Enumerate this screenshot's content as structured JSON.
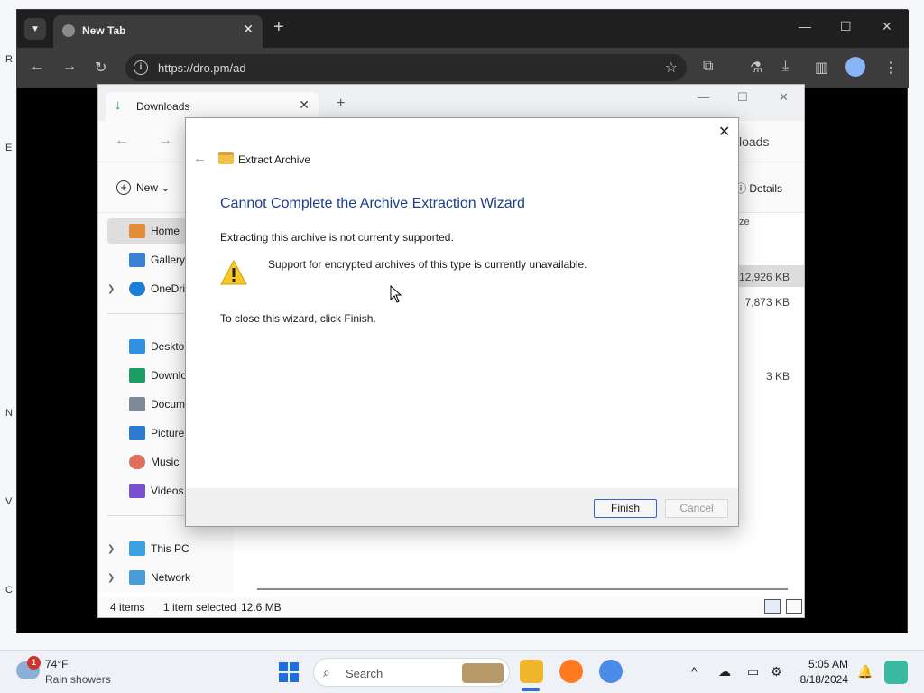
{
  "browser": {
    "tab_title": "New Tab",
    "url": "https://dro.pm/ad"
  },
  "explorer": {
    "tab_title": "Downloads",
    "location_partial": "loads",
    "new_label": "New",
    "details_label": "Details",
    "column_header_partial": "ze",
    "sidebar": [
      {
        "label": "Home",
        "selected": true,
        "icon": "home-icon"
      },
      {
        "label": "Gallery",
        "icon": "gallery-icon"
      },
      {
        "label": "OneDriv",
        "icon": "cloud-icon",
        "expandable": true
      },
      {
        "label": "Desktop",
        "icon": "desktop-icon"
      },
      {
        "label": "Downlo",
        "icon": "download-icon"
      },
      {
        "label": "Docume",
        "icon": "document-icon"
      },
      {
        "label": "Pictures",
        "icon": "pictures-icon"
      },
      {
        "label": "Music",
        "icon": "music-icon"
      },
      {
        "label": "Videos",
        "icon": "videos-icon"
      },
      {
        "label": "This PC",
        "icon": "pc-icon",
        "expandable": true
      },
      {
        "label": "Network",
        "icon": "network-icon",
        "expandable": true
      }
    ],
    "sizes": [
      "12,926 KB",
      "7,873 KB",
      "3 KB"
    ],
    "status": {
      "items": "4 items",
      "selected": "1 item selected",
      "size": "12.6 MB"
    }
  },
  "dialog": {
    "caption": "Extract Archive",
    "heading": "Cannot Complete the Archive Extraction Wizard",
    "message": "Extracting this archive is not currently supported.",
    "warning": "Support for encrypted archives of this type is currently unavailable.",
    "close_hint": "To close this wizard, click Finish.",
    "finish_label": "Finish",
    "cancel_label": "Cancel"
  },
  "taskbar": {
    "weather_badge": "1",
    "weather_temp": "74°F",
    "weather_desc": "Rain showers",
    "search_placeholder": "Search",
    "time": "5:05 AM",
    "date": "8/18/2024"
  },
  "colors": {
    "dialog_heading": "#1d3e8c",
    "finish_border": "#2f68c6",
    "accent": "#2f6fd6"
  }
}
